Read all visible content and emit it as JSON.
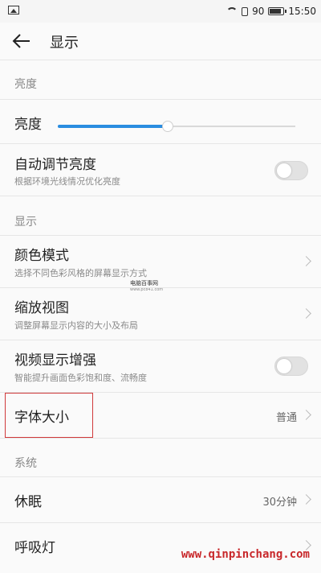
{
  "status_bar": {
    "battery": "90",
    "time": "15:50"
  },
  "header": {
    "title": "显示"
  },
  "sections": {
    "brightness": {
      "label": "亮度"
    },
    "display": {
      "label": "显示"
    },
    "system": {
      "label": "系统"
    }
  },
  "brightness_row": {
    "label": "亮度",
    "level": 0.46
  },
  "auto_brightness": {
    "title": "自动调节亮度",
    "subtitle": "根据环境光线情况优化亮度",
    "enabled": false
  },
  "color_mode": {
    "title": "颜色模式",
    "subtitle": "选择不同色彩风格的屏幕显示方式"
  },
  "zoom_view": {
    "title": "缩放视图",
    "subtitle": "调整屏幕显示内容的大小及布局"
  },
  "video_enhance": {
    "title": "视频显示增强",
    "subtitle": "智能提升画面色彩饱和度、流畅度",
    "enabled": false
  },
  "font_size": {
    "title": "字体大小",
    "value": "普通"
  },
  "sleep": {
    "title": "休眠",
    "value": "30分钟"
  },
  "breathing_light": {
    "title": "呼吸灯"
  },
  "watermark": {
    "site_name": "电脑百事网",
    "site_small": "www.pc841.com",
    "url": "www.qinpinchang.com"
  },
  "colors": {
    "accent": "#2a8de0",
    "highlight": "#d0393b",
    "watermark_url": "#c8282b"
  }
}
